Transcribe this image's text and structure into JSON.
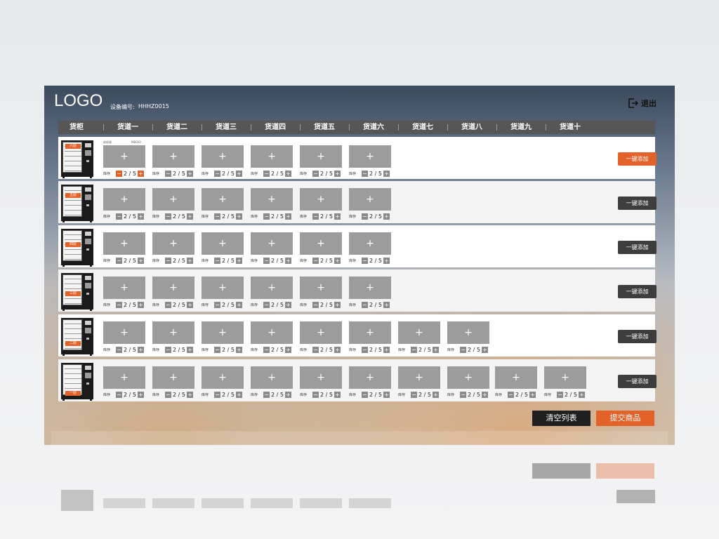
{
  "header": {
    "logo": "LOGO",
    "device_label": "设备编号:",
    "device_id": "HHHZ0015",
    "logout_label": "退出"
  },
  "columns": [
    "货柜",
    "货道一",
    "货道二",
    "货道三",
    "货道四",
    "货道五",
    "货道六",
    "货道七",
    "货道八",
    "货道九",
    "货道十"
  ],
  "slot": {
    "plus": "+",
    "stock_label": "库存",
    "minus": "−",
    "increment": "+",
    "quantity": "2 / 5"
  },
  "rows": [
    {
      "tier": "六层",
      "slots": 6,
      "add_label": "一键添加",
      "highlight": true,
      "note_left": "部部量",
      "note_right": "MB020"
    },
    {
      "tier": "五层",
      "slots": 6,
      "add_label": "一键添加",
      "highlight": false
    },
    {
      "tier": "四层",
      "slots": 6,
      "add_label": "一键添加",
      "highlight": false
    },
    {
      "tier": "三层",
      "slots": 6,
      "add_label": "一键添加",
      "highlight": false
    },
    {
      "tier": "二层",
      "slots": 8,
      "add_label": "一键添加",
      "highlight": false
    },
    {
      "tier": "一层",
      "slots": 10,
      "add_label": "一键添加",
      "highlight": false
    }
  ],
  "actions": {
    "clear_label": "清空列表",
    "submit_label": "提交商品"
  },
  "colors": {
    "accent": "#e2622a",
    "dark_button": "#3d3d3d",
    "slot_gray": "#9c9c9c",
    "header_bar": "#565656"
  }
}
